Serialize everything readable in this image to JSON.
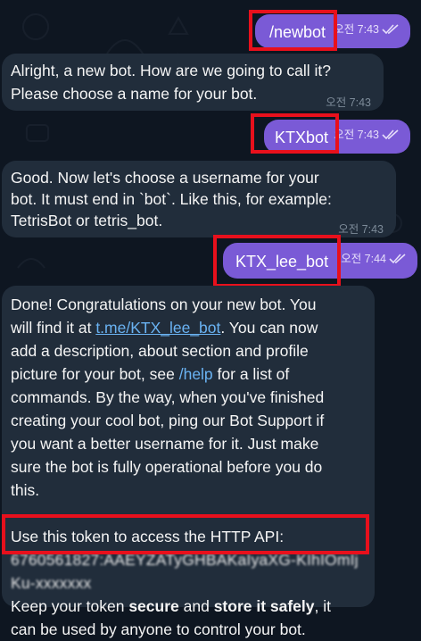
{
  "conversation": {
    "messages": [
      {
        "dir": "out",
        "text": "/newbot",
        "time": "오전 7:43"
      },
      {
        "dir": "in",
        "lines": [
          "Alright, a new bot. How are we going to call it?",
          "Please choose a name for your bot."
        ],
        "time": "오전 7:43"
      },
      {
        "dir": "out",
        "text": "KTXbot",
        "time": "오전 7:43"
      },
      {
        "dir": "in",
        "lines": [
          "Good. Now let's choose a username for your",
          "bot. It must end in `bot`. Like this, for example:",
          "TetrisBot or tetris_bot."
        ],
        "time": "오전 7:43"
      },
      {
        "dir": "out",
        "text": "KTX_lee_bot",
        "time": "오전 7:44"
      }
    ],
    "final": {
      "l1": "Done! Congratulations on your new bot. You",
      "l2_a": "will find it at ",
      "l2_link": "t.me/KTX_lee_bot",
      "l2_b": ". You can now",
      "l3": "add a description, about section and profile",
      "l4_a": "picture for your bot, see ",
      "l4_cmd": "/help",
      "l4_b": " for a list of",
      "l5": "commands. By the way, when you've finished",
      "l6": "creating your cool bot, ping our Bot Support if",
      "l7": "you want a better username for it. Just make",
      "l8": "sure the bot is fully operational before you do",
      "l9": "this.",
      "l10": "Use this token to access the HTTP API:",
      "token1": "6760561827:AAEYZATyGHBAKaIyaXG-KIhIOmIj",
      "token2": "Ku-xxxxxxx",
      "l11_a": "Keep your token ",
      "l11_b1": "secure",
      "l11_c": " and ",
      "l11_b2": "store it safely",
      "l11_d": ", it",
      "l12": "can be used by anyone to control your bot."
    }
  },
  "colors": {
    "background": "#0e1621",
    "outgoing_bubble": "#7a5ad6",
    "incoming_bubble": "#212d3b",
    "link": "#6ab3f3",
    "highlight": "#e8101c"
  }
}
